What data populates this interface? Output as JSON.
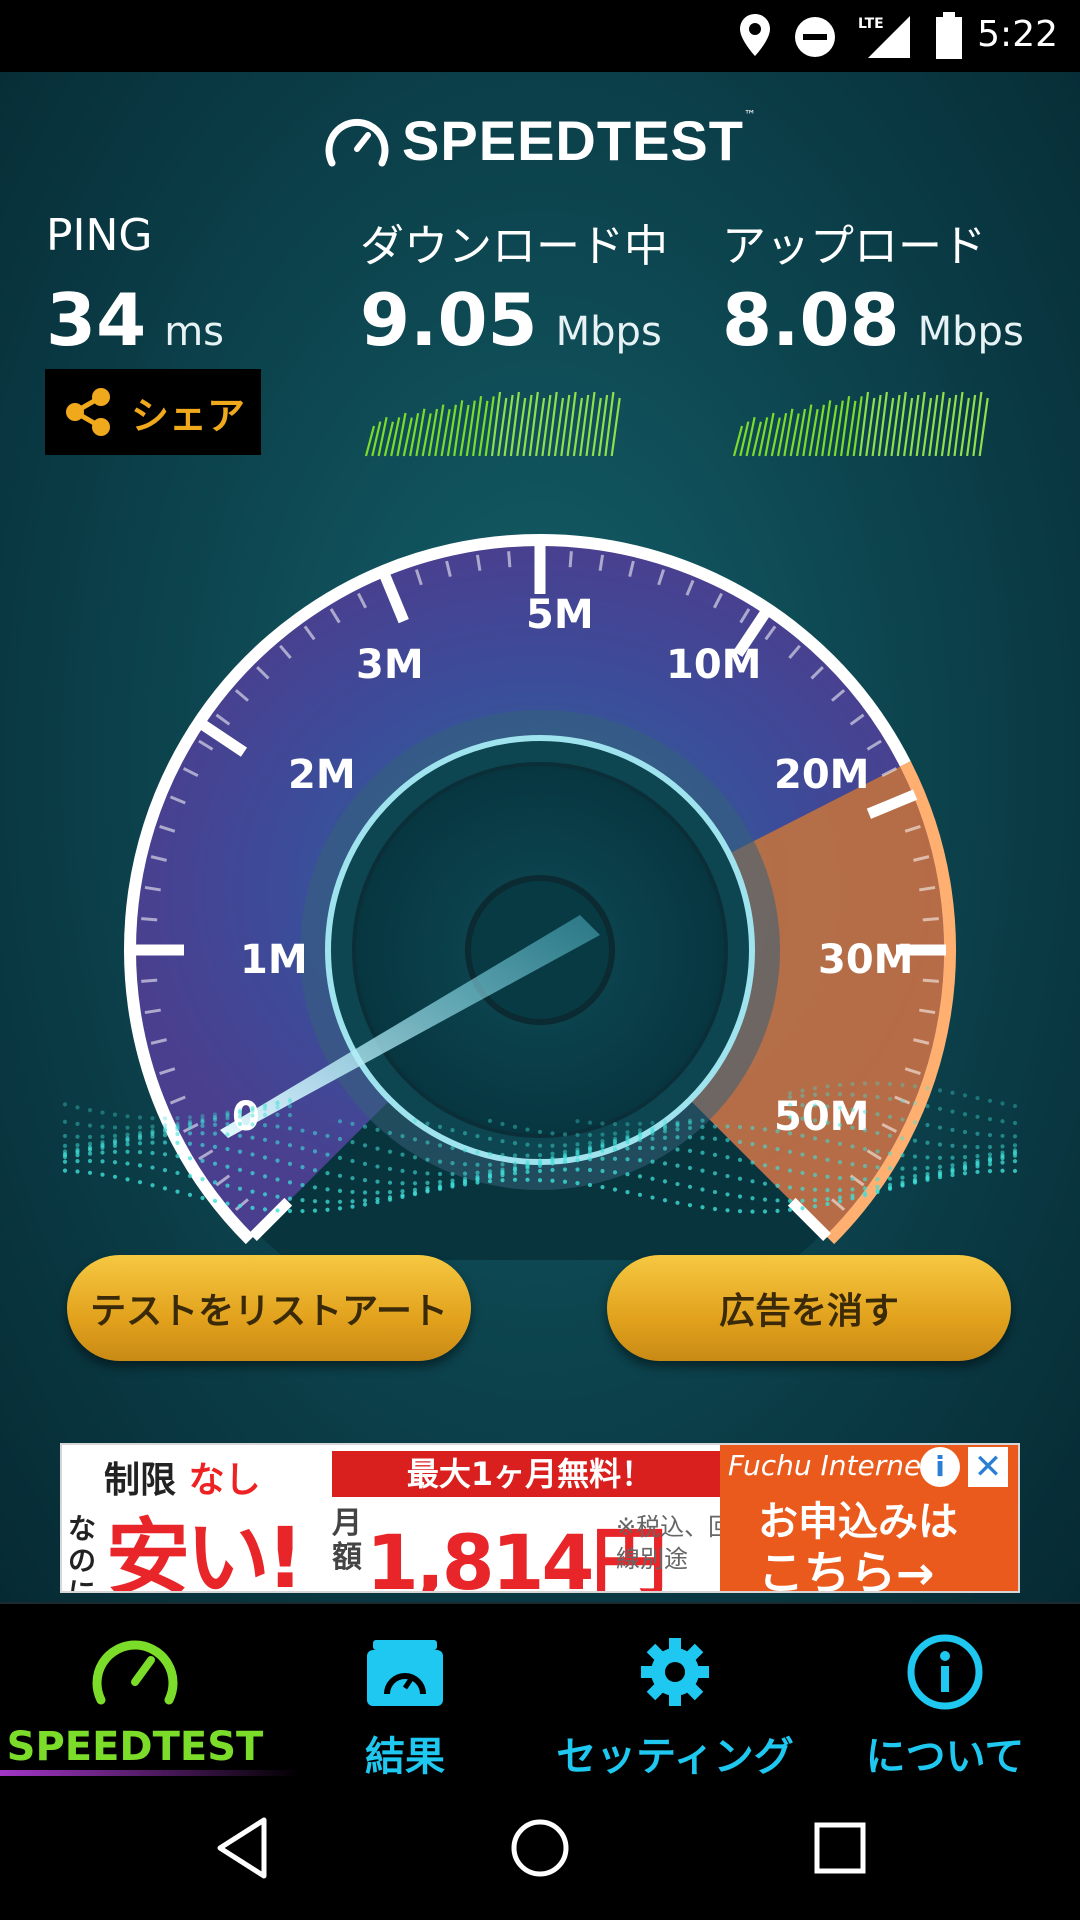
{
  "status_bar": {
    "time": "5:22",
    "network": "LTE",
    "icons": [
      "location-icon",
      "do-not-disturb-icon",
      "lte-signal-icon",
      "battery-icon"
    ]
  },
  "header": {
    "logo_text": "SPEEDTEST",
    "trademark": "™"
  },
  "ping": {
    "label": "PING",
    "value": "34",
    "unit": "ms"
  },
  "download": {
    "label": "ダウンロード中",
    "value": "9.05",
    "unit": "Mbps"
  },
  "upload": {
    "label": "アップロード",
    "value": "8.08",
    "unit": "Mbps"
  },
  "share": {
    "label": "シェア"
  },
  "gauge": {
    "ticks": [
      "0",
      "1M",
      "2M",
      "3M",
      "5M",
      "10M",
      "20M",
      "30M",
      "50M"
    ],
    "max_value_label": "50M",
    "needle_reading_label": "0"
  },
  "buttons": {
    "restart": "テストをリストアート",
    "remove_ads": "広告を消す"
  },
  "ad": {
    "unlimited_prefix": "制限",
    "unlimited": "なし",
    "side_text": "なのに",
    "cheap": "安い!",
    "banner": "最大1ヶ月無料！",
    "monthly": "月額",
    "price": "1,814円",
    "note": "※税込、回線別途",
    "brand": "Fuchu Internet",
    "cta_line1": "お申込みは",
    "cta_line2": "こちら→",
    "info": "i",
    "close": "✕"
  },
  "tabs": [
    {
      "label": "SPEEDTEST",
      "icon": "speedometer-icon",
      "active": true,
      "color": "#7bdc2a"
    },
    {
      "label": "結果",
      "icon": "results-folder-icon",
      "active": false,
      "color": "#1ec8f0"
    },
    {
      "label": "セッティング",
      "icon": "gear-icon",
      "active": false,
      "color": "#1ec8f0"
    },
    {
      "label": "について",
      "icon": "info-icon",
      "active": false,
      "color": "#1ec8f0"
    }
  ],
  "nav": {
    "icons": [
      "back-icon",
      "home-icon",
      "recents-icon"
    ]
  },
  "colors": {
    "accent_orange": "#f0a91c",
    "tab_active": "#7bdc2a",
    "tab_inactive": "#1ec8f0",
    "gauge_purple": "#6a5bd8",
    "gauge_orange": "#e8862a"
  }
}
